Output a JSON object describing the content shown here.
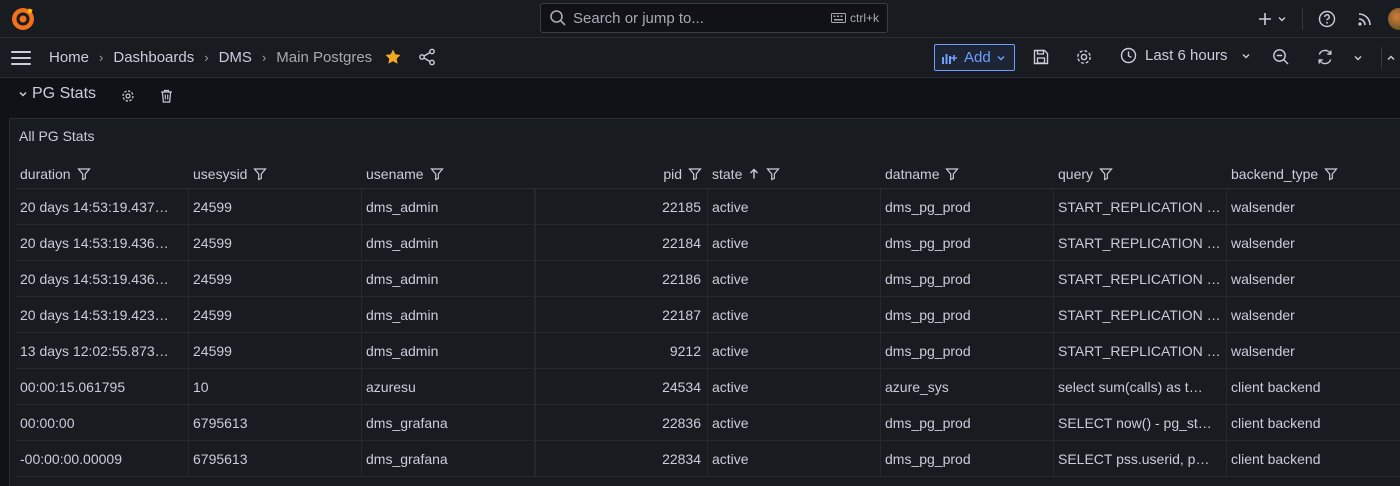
{
  "search": {
    "placeholder": "Search or jump to...",
    "shortcut": "ctrl+k"
  },
  "breadcrumb": {
    "home": "Home",
    "dashboards": "Dashboards",
    "folder": "DMS",
    "current": "Main Postgres"
  },
  "toolbar": {
    "add_label": "Add",
    "time_range": "Last 6 hours"
  },
  "row": {
    "title": "PG Stats"
  },
  "panel": {
    "title": "All PG Stats"
  },
  "columns": [
    {
      "key": "duration",
      "label": "duration"
    },
    {
      "key": "usesysid",
      "label": "usesysid"
    },
    {
      "key": "usename",
      "label": "usename"
    },
    {
      "key": "pid",
      "label": "pid"
    },
    {
      "key": "state",
      "label": "state"
    },
    {
      "key": "datname",
      "label": "datname"
    },
    {
      "key": "query",
      "label": "query"
    },
    {
      "key": "backend_type",
      "label": "backend_type"
    }
  ],
  "rows": [
    {
      "duration": "20 days 14:53:19.437…",
      "usesysid": "24599",
      "usename": "dms_admin",
      "pid": "22185",
      "state": "active",
      "datname": "dms_pg_prod",
      "query": "START_REPLICATION …",
      "backend_type": "walsender"
    },
    {
      "duration": "20 days 14:53:19.436…",
      "usesysid": "24599",
      "usename": "dms_admin",
      "pid": "22184",
      "state": "active",
      "datname": "dms_pg_prod",
      "query": "START_REPLICATION …",
      "backend_type": "walsender"
    },
    {
      "duration": "20 days 14:53:19.436…",
      "usesysid": "24599",
      "usename": "dms_admin",
      "pid": "22186",
      "state": "active",
      "datname": "dms_pg_prod",
      "query": "START_REPLICATION …",
      "backend_type": "walsender"
    },
    {
      "duration": "20 days 14:53:19.423…",
      "usesysid": "24599",
      "usename": "dms_admin",
      "pid": "22187",
      "state": "active",
      "datname": "dms_pg_prod",
      "query": "START_REPLICATION …",
      "backend_type": "walsender"
    },
    {
      "duration": "13 days 12:02:55.873…",
      "usesysid": "24599",
      "usename": "dms_admin",
      "pid": "9212",
      "state": "active",
      "datname": "dms_pg_prod",
      "query": "START_REPLICATION …",
      "backend_type": "walsender"
    },
    {
      "duration": "00:00:15.061795",
      "usesysid": "10",
      "usename": "azuresu",
      "pid": "24534",
      "state": "active",
      "datname": "azure_sys",
      "query": "select sum(calls) as t…",
      "backend_type": "client backend"
    },
    {
      "duration": "00:00:00",
      "usesysid": "6795613",
      "usename": "dms_grafana",
      "pid": "22836",
      "state": "active",
      "datname": "dms_pg_prod",
      "query": "SELECT now() - pg_st…",
      "backend_type": "client backend"
    },
    {
      "duration": "-00:00:00.00009",
      "usesysid": "6795613",
      "usename": "dms_grafana",
      "pid": "22834",
      "state": "active",
      "datname": "dms_pg_prod",
      "query": "SELECT pss.userid, p…",
      "backend_type": "client backend"
    }
  ],
  "colors": {
    "background": "#111217",
    "panel": "#181b1f",
    "accent": "#6e9fff",
    "star": "#f5a623",
    "text": "#ccccdc"
  }
}
